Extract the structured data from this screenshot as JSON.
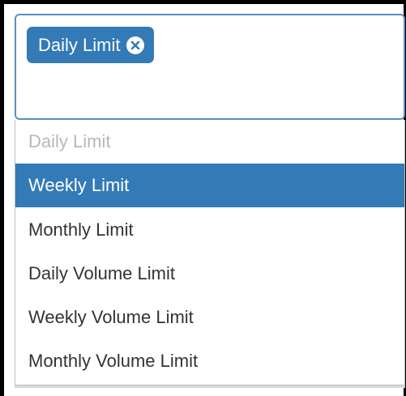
{
  "select": {
    "selected_tags": [
      {
        "label": "Daily Limit"
      }
    ],
    "options": [
      {
        "label": "Daily Limit",
        "state": "disabled"
      },
      {
        "label": "Weekly Limit",
        "state": "highlighted"
      },
      {
        "label": "Monthly Limit",
        "state": "normal"
      },
      {
        "label": "Daily Volume Limit",
        "state": "normal"
      },
      {
        "label": "Weekly Volume Limit",
        "state": "normal"
      },
      {
        "label": "Monthly Volume Limit",
        "state": "normal"
      }
    ]
  },
  "icons": {
    "tag_remove": "close-circle-icon"
  },
  "colors": {
    "accent": "#337ab7",
    "focus_border": "#5b8ec1",
    "text": "#333333",
    "disabled_text": "#b8b8b8"
  }
}
